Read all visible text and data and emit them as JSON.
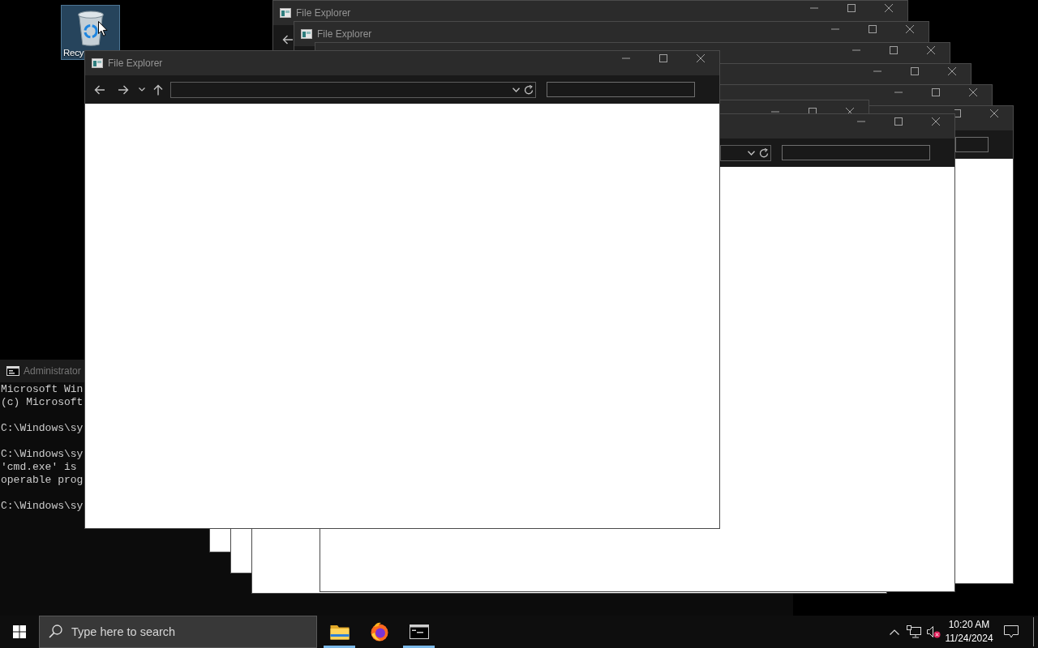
{
  "desktop": {
    "icons": [
      {
        "label": "Recy",
        "selected": true
      }
    ]
  },
  "windows": [
    {
      "kind": "console",
      "title": "Administrator",
      "blocks": [
        [
          "Microsoft Win",
          "(c) Microsoft"
        ],
        [
          "C:\\Windows\\sy"
        ],
        [
          "C:\\Windows\\sy",
          "'cmd.exe' is",
          "operable prog"
        ],
        [
          "C:\\Windows\\sy"
        ]
      ]
    },
    {
      "kind": "explorer",
      "title": "File Explorer"
    },
    {
      "kind": "explorer",
      "title": "File Explorer"
    },
    {
      "kind": "explorer"
    },
    {
      "kind": "explorer"
    },
    {
      "kind": "explorer"
    },
    {
      "kind": "explorer"
    },
    {
      "kind": "explorer"
    },
    {
      "kind": "explorer"
    },
    {
      "kind": "explorer"
    },
    {
      "kind": "explorer"
    },
    {
      "kind": "explorer",
      "title": "File Explorer"
    }
  ],
  "taskbar": {
    "search": {
      "placeholder": "Type here to search"
    },
    "apps": [
      {
        "kind": "folder",
        "running": true
      },
      {
        "kind": "browser",
        "running": false
      },
      {
        "kind": "terminal",
        "running": true
      }
    ],
    "tray": {
      "volume": {
        "muted": true
      },
      "time": "10:20 AM",
      "date": "11/24/2024"
    }
  }
}
